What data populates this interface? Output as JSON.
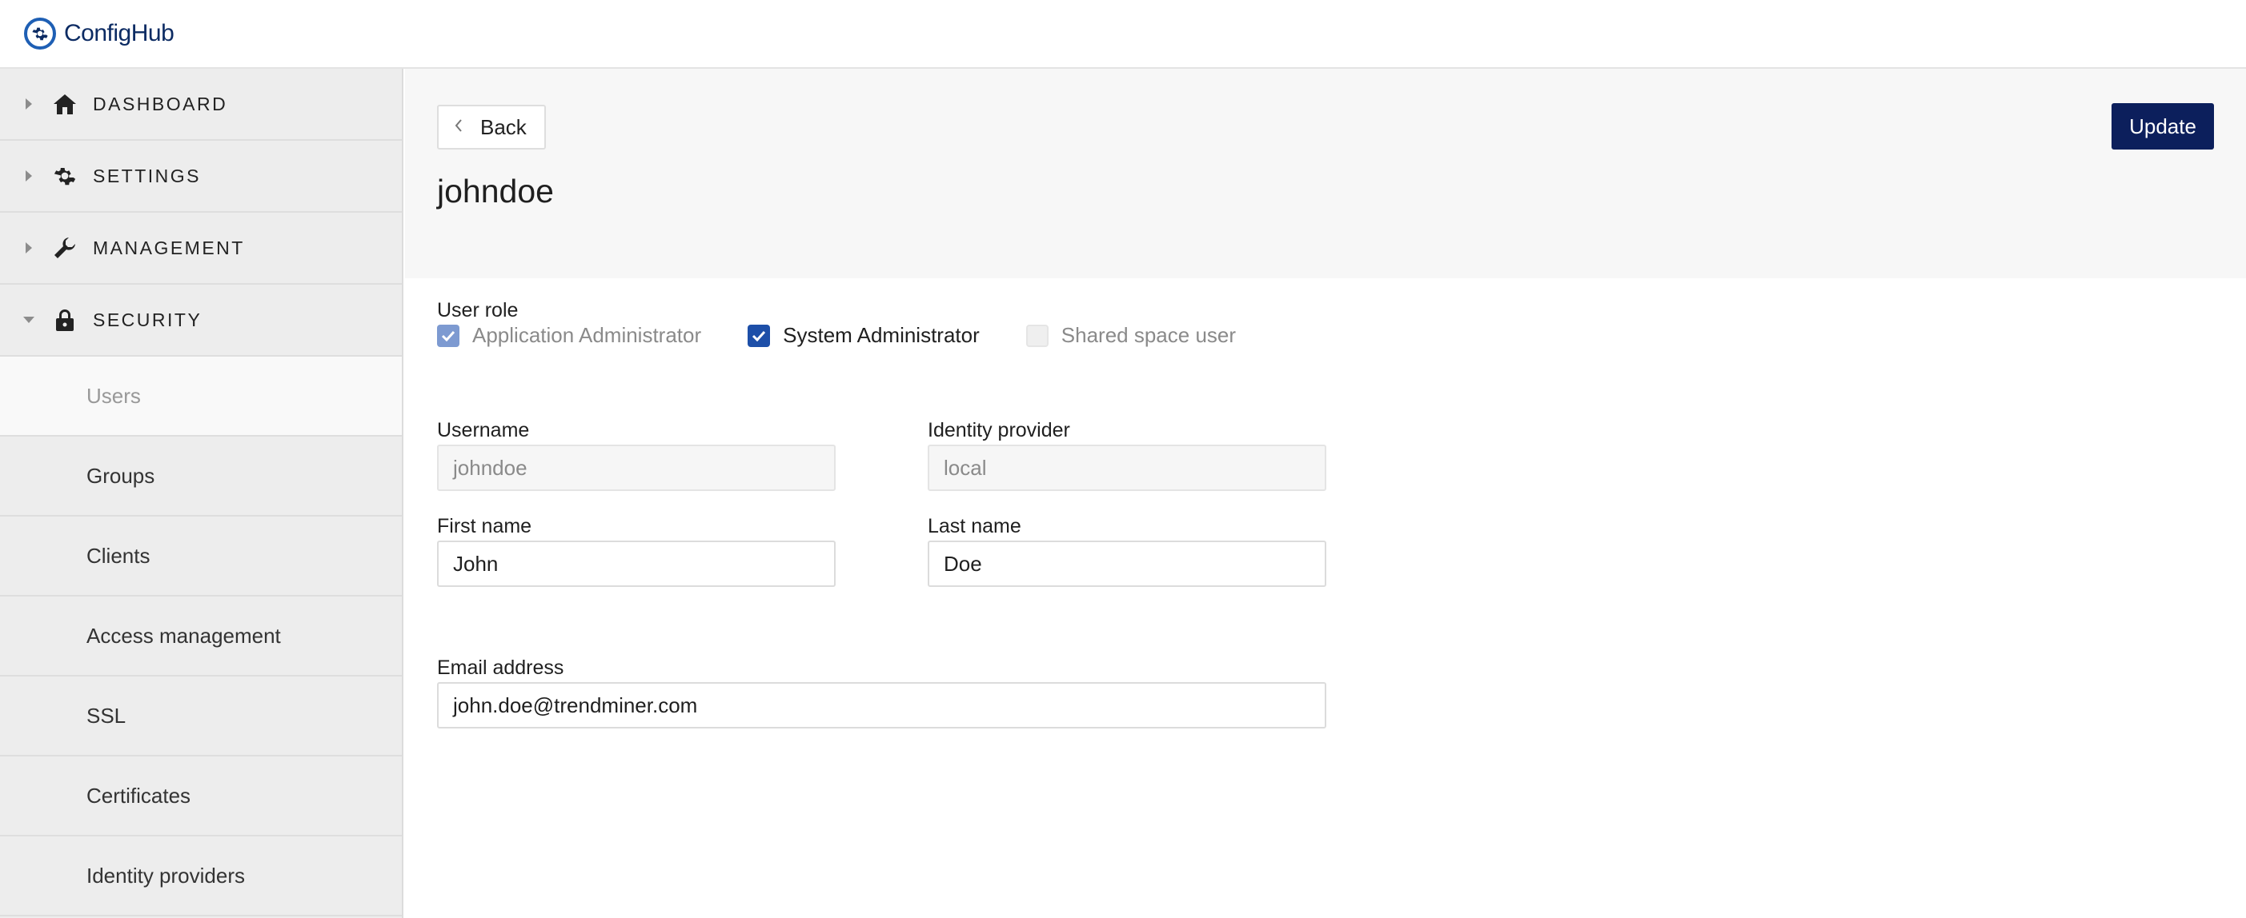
{
  "app": {
    "brand": "ConfigHub"
  },
  "sidebar": {
    "sections": [
      {
        "label": "DASHBOARD",
        "icon": "home-icon",
        "expanded": false
      },
      {
        "label": "SETTINGS",
        "icon": "gear-icon",
        "expanded": false
      },
      {
        "label": "MANAGEMENT",
        "icon": "wrench-icon",
        "expanded": false
      },
      {
        "label": "SECURITY",
        "icon": "lock-icon",
        "expanded": true
      }
    ],
    "security_items": [
      {
        "label": "Users",
        "active": true
      },
      {
        "label": "Groups"
      },
      {
        "label": "Clients"
      },
      {
        "label": "Access management"
      },
      {
        "label": "SSL"
      },
      {
        "label": "Certificates"
      },
      {
        "label": "Identity providers"
      }
    ]
  },
  "header": {
    "back_label": "Back",
    "update_label": "Update",
    "title": "johndoe"
  },
  "form": {
    "user_role_label": "User role",
    "roles": [
      {
        "label": "Application Administrator",
        "checked": true,
        "disabled": true
      },
      {
        "label": "System Administrator",
        "checked": true,
        "disabled": false
      },
      {
        "label": "Shared space user",
        "checked": false,
        "disabled": true
      }
    ],
    "username": {
      "label": "Username",
      "value": "johndoe"
    },
    "identity_provider": {
      "label": "Identity provider",
      "value": "local"
    },
    "first_name": {
      "label": "First name",
      "value": "John"
    },
    "last_name": {
      "label": "Last name",
      "value": "Doe"
    },
    "email": {
      "label": "Email address",
      "value": "john.doe@trendminer.com"
    }
  },
  "colors": {
    "accent": "#1d4fa8",
    "update_button": "#0c1f5c",
    "brand": "#0c2b63"
  }
}
